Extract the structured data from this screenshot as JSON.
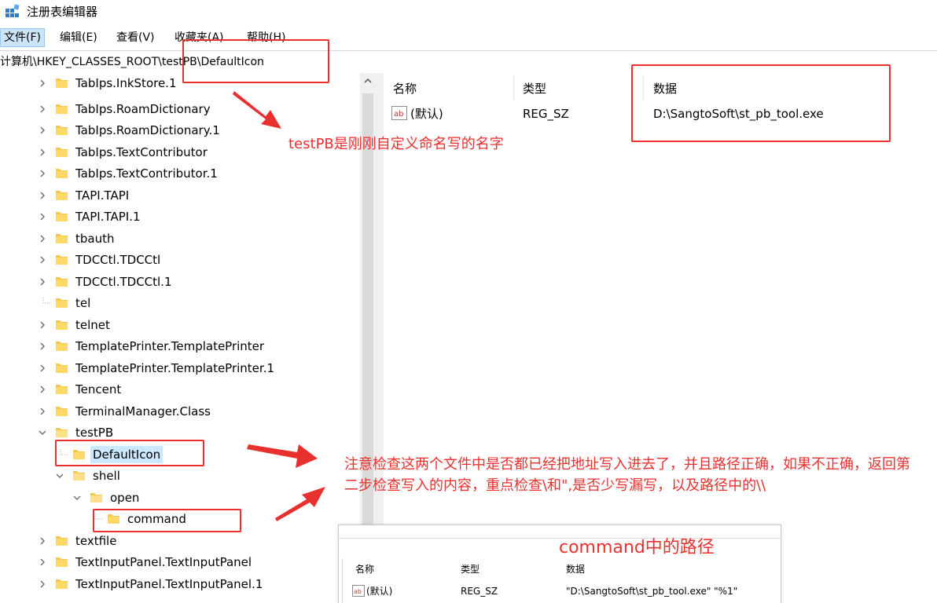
{
  "window": {
    "title": "注册表编辑器"
  },
  "menu": {
    "items": [
      "文件(F)",
      "编辑(E)",
      "查看(V)",
      "收藏夹(A)",
      "帮助(H)"
    ]
  },
  "address": {
    "path": "计算机\\HKEY_CLASSES_ROOT\\testPB\\DefaultIcon"
  },
  "tree": {
    "items": [
      "TabIps.InkStore.1",
      "TabIps.RoamDictionary",
      "TabIps.RoamDictionary.1",
      "TabIps.TextContributor",
      "TabIps.TextContributor.1",
      "TAPI.TAPI",
      "TAPI.TAPI.1",
      "tbauth",
      "TDCCtl.TDCCtl",
      "TDCCtl.TDCCtl.1",
      "tel",
      "telnet",
      "TemplatePrinter.TemplatePrinter",
      "TemplatePrinter.TemplatePrinter.1",
      "Tencent",
      "TerminalManager.Class",
      "testPB",
      "DefaultIcon",
      "shell",
      "open",
      "command",
      "textfile",
      "TextInputPanel.TextInputPanel",
      "TextInputPanel.TextInputPanel.1"
    ],
    "selected": "DefaultIcon"
  },
  "values": {
    "columns": {
      "name": "名称",
      "type": "类型",
      "data": "数据"
    },
    "row": {
      "name": "(默认)",
      "type": "REG_SZ",
      "data": "D:\\SangtoSoft\\st_pb_tool.exe"
    }
  },
  "annotations": {
    "note1": "testPB是刚刚自定义命名写的名字",
    "note2": "注意检查这两个文件中是否都已经把地址写入进去了，并且路径正确，如果不正确，返回第二步检查写入的内容，重点检查\\和\",是否少写漏写，以及路径中的\\\\",
    "inset_title": "command中的路径"
  },
  "inset": {
    "columns": {
      "name": "名称",
      "type": "类型",
      "data": "数据"
    },
    "row": {
      "name": "(默认)",
      "type": "REG_SZ",
      "data": "\"D:\\SangtoSoft\\st_pb_tool.exe\" \"%1\""
    }
  },
  "colors": {
    "annotation_red": "#e8312f",
    "folder_yellow": "#f5c84c",
    "selection_blue": "#cce8ff"
  }
}
